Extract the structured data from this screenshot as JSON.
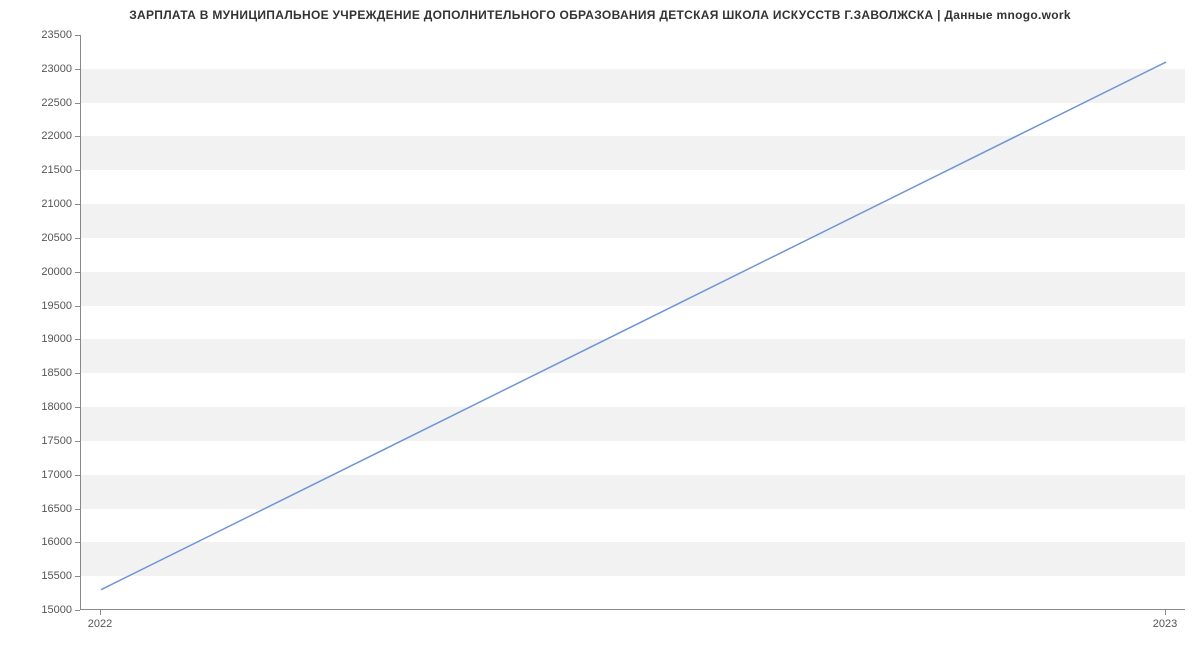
{
  "chart_data": {
    "type": "line",
    "title": "ЗАРПЛАТА В МУНИЦИПАЛЬНОЕ УЧРЕЖДЕНИЕ ДОПОЛНИТЕЛЬНОГО ОБРАЗОВАНИЯ ДЕТСКАЯ ШКОЛА ИСКУССТВ Г.ЗАВОЛЖСКА | Данные mnogo.work",
    "xlabel": "",
    "ylabel": "",
    "x": [
      "2022",
      "2023"
    ],
    "values": [
      15300,
      23100
    ],
    "ylim": [
      15000,
      23500
    ],
    "yticks": [
      15000,
      15500,
      16000,
      16500,
      17000,
      17500,
      18000,
      18500,
      19000,
      19500,
      20000,
      20500,
      21000,
      21500,
      22000,
      22500,
      23000,
      23500
    ],
    "xticks": [
      "2022",
      "2023"
    ],
    "line_color": "#6e95d8"
  }
}
